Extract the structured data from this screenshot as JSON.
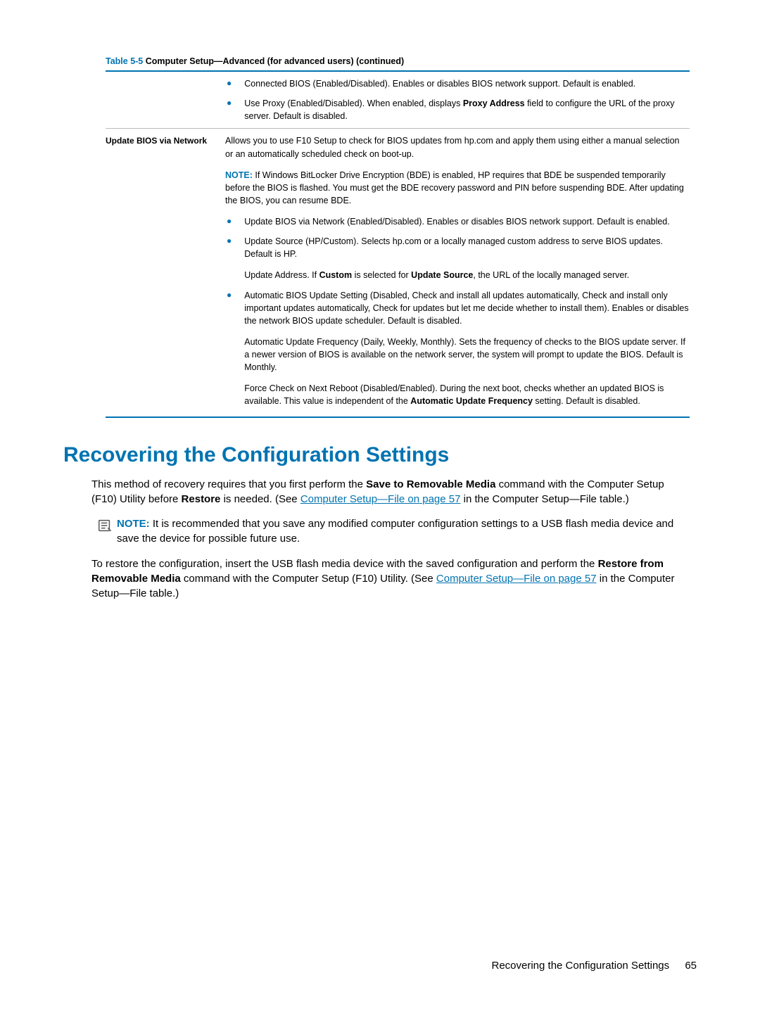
{
  "tableCaption": {
    "number": "Table 5-5",
    "title": "  Computer Setup—Advanced (for advanced users) (continued)"
  },
  "row1": {
    "label": "",
    "b1": "Connected BIOS (Enabled/Disabled). Enables or disables BIOS network support. Default is enabled.",
    "b2a": "Use Proxy (Enabled/Disabled). When enabled, displays ",
    "b2bold": "Proxy Address",
    "b2b": " field to configure the URL of the proxy server. Default is disabled."
  },
  "row2": {
    "label": "Update BIOS via Network",
    "intro": "Allows you to use F10 Setup to check for BIOS updates from hp.com and apply them using either a manual selection or an automatically scheduled check on boot-up.",
    "noteLabel": "NOTE:",
    "noteText": "   If Windows BitLocker Drive Encryption (BDE) is enabled, HP requires that BDE be suspended temporarily before the BIOS is flashed. You must get the BDE recovery password and PIN before suspending BDE. After updating the BIOS, you can resume BDE.",
    "b1": "Update BIOS via Network (Enabled/Disabled). Enables or disables BIOS network support. Default is enabled.",
    "b2": "Update Source (HP/Custom). Selects hp.com or a locally managed custom address to serve BIOS updates. Default is HP.",
    "b2sub_a": "Update Address. If ",
    "b2sub_bold1": "Custom",
    "b2sub_b": " is selected for ",
    "b2sub_bold2": "Update Source",
    "b2sub_c": ", the URL of the locally managed server.",
    "b3": "Automatic BIOS Update Setting (Disabled, Check and install all updates automatically, Check and install only important updates automatically, Check for updates but let me decide whether to install them). Enables or disables the network BIOS update scheduler. Default is disabled.",
    "b3sub": "Automatic Update Frequency (Daily, Weekly, Monthly). Sets the frequency of checks to the BIOS update server. If a newer version of BIOS is available on the network server, the system will prompt to update the BIOS. Default is Monthly.",
    "b4a": "Force Check on Next Reboot (Disabled/Enabled). During the next boot, checks whether an updated BIOS is available. This value is independent of the ",
    "b4bold": "Automatic Update Frequency",
    "b4b": " setting. Default is disabled."
  },
  "heading": "Recovering the Configuration Settings",
  "p1": {
    "a": "This method of recovery requires that you first perform the ",
    "bold1": "Save to Removable Media",
    "b": " command with the Computer Setup (F10) Utility before ",
    "bold2": "Restore",
    "c": " is needed. (See ",
    "link": "Computer Setup—File on page 57",
    "d": " in the Computer Setup—File table.)"
  },
  "note": {
    "label": "NOTE:",
    "text": "   It is recommended that you save any modified computer configuration settings to a USB flash media device and save the device for possible future use."
  },
  "p2": {
    "a": "To restore the configuration, insert the USB flash media device with the saved configuration and perform the ",
    "bold1": "Restore from Removable Media",
    "b": " command with the Computer Setup (F10) Utility. (See ",
    "link": "Computer Setup—File on page 57",
    "c": " in the Computer Setup—File table.)"
  },
  "footer": {
    "title": "Recovering the Configuration Settings",
    "page": "65"
  }
}
